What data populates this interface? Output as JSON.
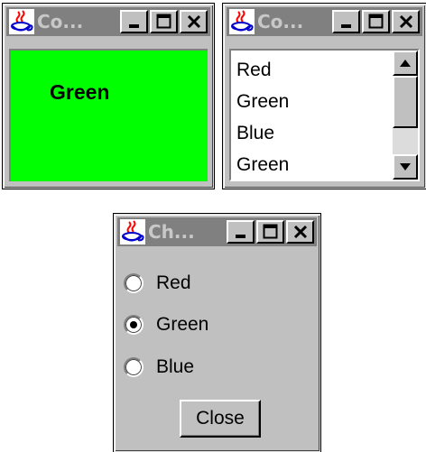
{
  "windows": {
    "color_panel": {
      "title": "Co...",
      "label": "Green",
      "background": "#00ff00"
    },
    "list_window": {
      "title": "Co...",
      "items": [
        "Red",
        "Green",
        "Blue",
        "Green"
      ]
    },
    "choice_window": {
      "title": "Ch...",
      "options": [
        {
          "label": "Red",
          "selected": false
        },
        {
          "label": "Green",
          "selected": true
        },
        {
          "label": "Blue",
          "selected": false
        }
      ],
      "close_label": "Close"
    }
  },
  "icons": {
    "app": "java-coffee-cup-icon",
    "minimize": "minimize-icon",
    "maximize": "maximize-icon",
    "close": "close-icon",
    "scroll_up": "arrow-up-icon",
    "scroll_down": "arrow-down-icon"
  },
  "colors": {
    "titlebar_inactive": "#808080",
    "window_face": "#c0c0c0",
    "title_text": "#c8c8c8"
  }
}
